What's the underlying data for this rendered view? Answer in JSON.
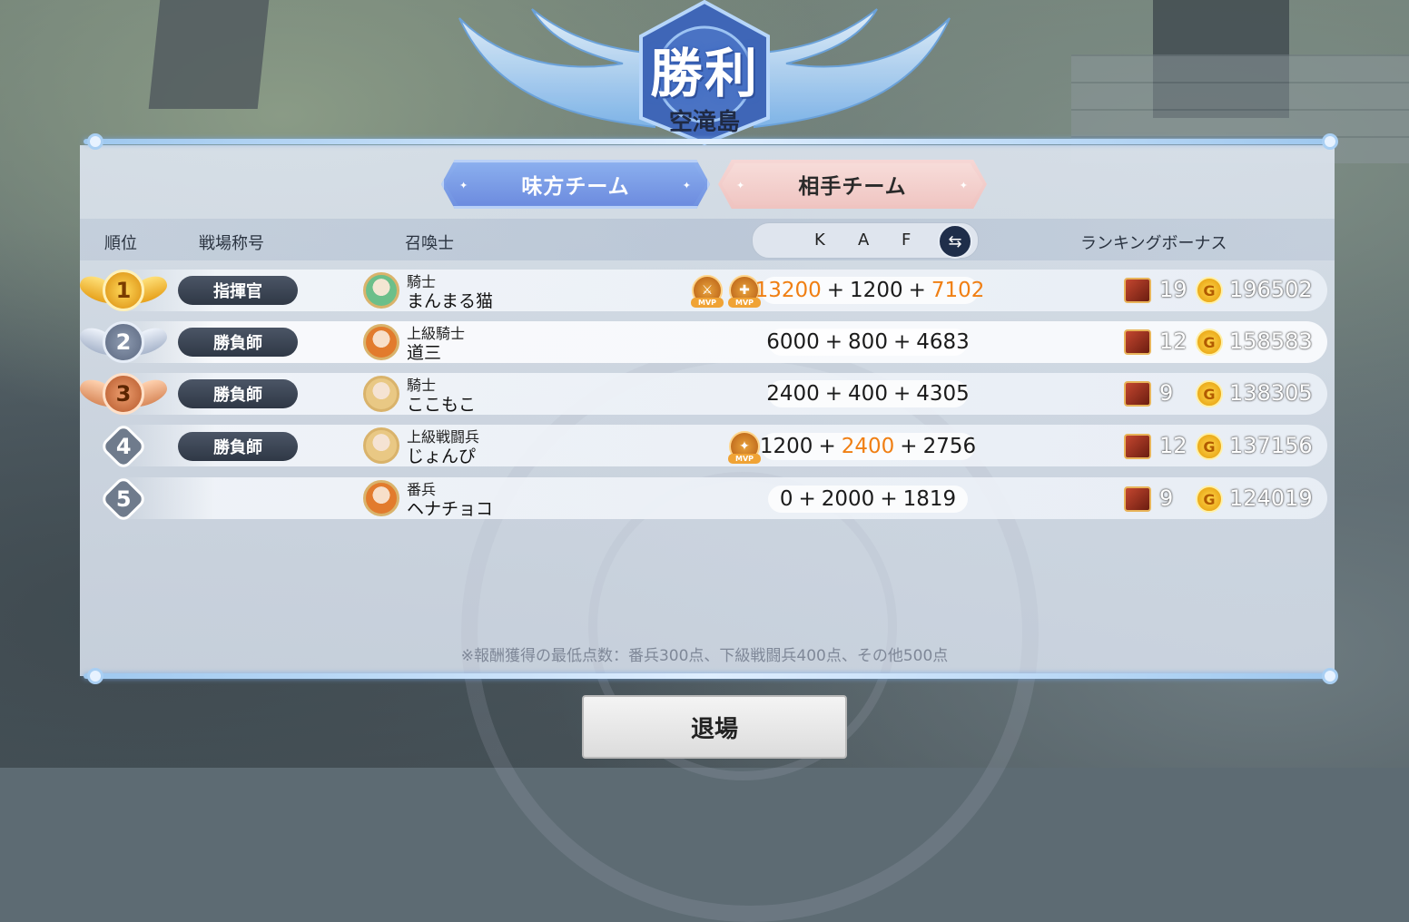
{
  "header": {
    "title": "勝利",
    "subtitle": "空滝島"
  },
  "tabs": {
    "ally": "味方チーム",
    "enemy": "相手チーム"
  },
  "columns": {
    "rank": "順位",
    "title": "戦場称号",
    "summoner": "召喚士",
    "k": "K",
    "a": "A",
    "f": "F",
    "bonus": "ランキングボーナス"
  },
  "rows": [
    {
      "rank": "1",
      "title": "指揮官",
      "class": "騎士",
      "name": "まんまる猫",
      "k": "13200",
      "a": "1200",
      "f": "7102",
      "chests": "19",
      "gold": "196502"
    },
    {
      "rank": "2",
      "title": "勝負師",
      "class": "上級騎士",
      "name": "道三",
      "k": "6000",
      "a": "800",
      "f": "4683",
      "chests": "12",
      "gold": "158583"
    },
    {
      "rank": "3",
      "title": "勝負師",
      "class": "騎士",
      "name": "ここもこ",
      "k": "2400",
      "a": "400",
      "f": "4305",
      "chests": "9",
      "gold": "138305"
    },
    {
      "rank": "4",
      "title": "勝負師",
      "class": "上級戦闘兵",
      "name": "じょんぴ",
      "k": "1200",
      "a": "2400",
      "f": "2756",
      "chests": "12",
      "gold": "137156"
    },
    {
      "rank": "5",
      "title": "",
      "class": "番兵",
      "name": "ヘナチョコ",
      "k": "0",
      "a": "2000",
      "f": "1819",
      "chests": "9",
      "gold": "124019"
    }
  ],
  "icons": {
    "plus": "+",
    "mvp": "MVP",
    "coin": "G",
    "swap": "⇆"
  },
  "footnote": "※報酬獲得の最低点数：番兵300点、下級戦闘兵400点、その他500点",
  "exit_button": "退場",
  "colors": {
    "accent_orange": "#f07f13",
    "ally_tab": "#7f9fe8",
    "enemy_tab": "#f2cbc8"
  }
}
